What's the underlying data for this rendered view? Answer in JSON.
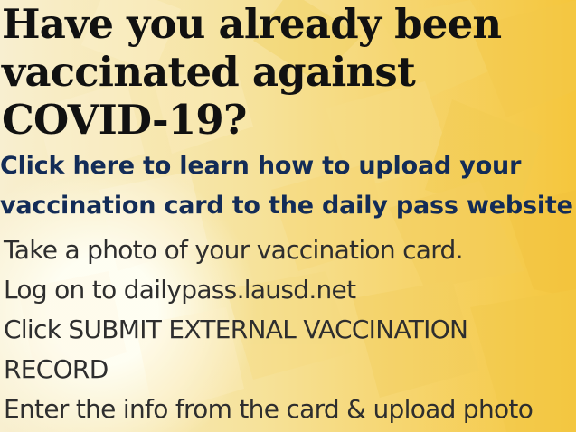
{
  "headline": {
    "lines": [
      "Have you already been",
      "vaccinated against",
      "COVID-19?"
    ]
  },
  "link": {
    "lines": [
      "Click here to learn how to upload your",
      "vaccination card to the daily pass website"
    ]
  },
  "steps": [
    "Take a photo of your vaccination card.",
    "Log on to dailypass.lausd.net",
    "Click SUBMIT EXTERNAL VACCINATION RECORD",
    "Enter the info from the card & upload photo"
  ],
  "colors": {
    "headline_text": "#111111",
    "link_text": "#132c57",
    "body_text": "#2e2e2e",
    "background_light": "#f8efd0",
    "background_gold": "#f5c63c"
  }
}
